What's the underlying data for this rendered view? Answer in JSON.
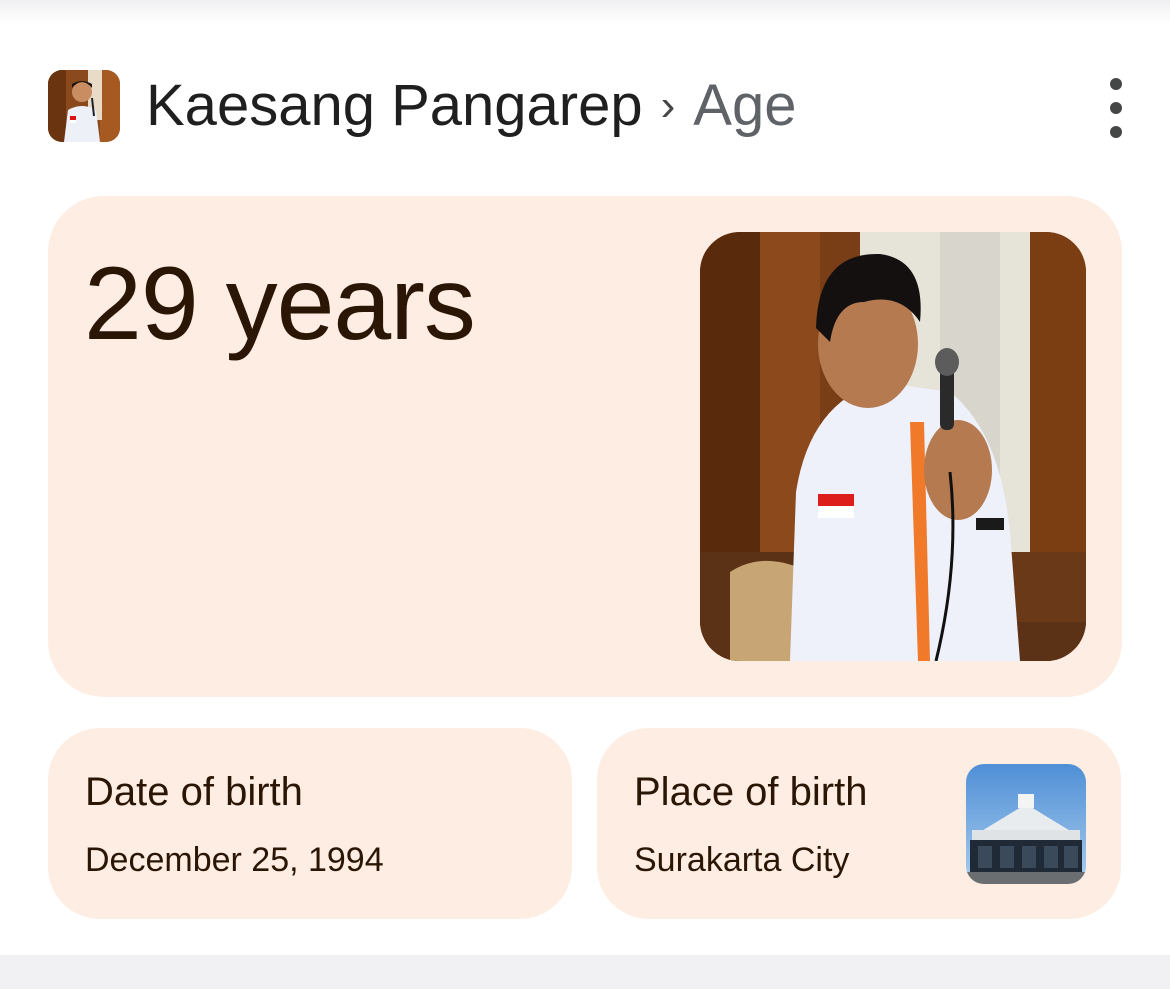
{
  "header": {
    "entity": "Kaesang Pangarep",
    "separator": "›",
    "attribute": "Age",
    "avatar_icon": "person-photo",
    "more_icon": "more-vert-icon"
  },
  "answer": {
    "value": "29 years",
    "image_icon": "portrait-photo"
  },
  "facts": [
    {
      "title": "Date of birth",
      "value": "December 25, 1994"
    },
    {
      "title": "Place of birth",
      "value": "Surakarta City",
      "image_icon": "building-photo"
    }
  ],
  "colors": {
    "card_background": "#feede2",
    "card_text": "#2b1606",
    "title_text": "#1f1f1f",
    "attribute_text": "#5f6368"
  }
}
